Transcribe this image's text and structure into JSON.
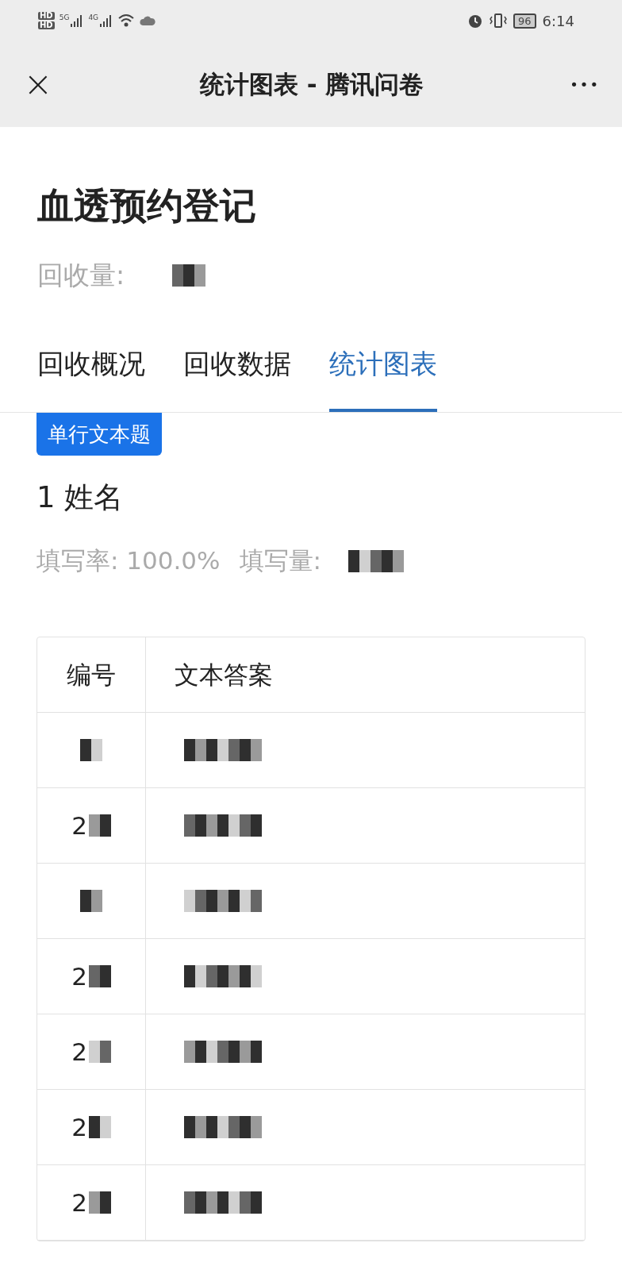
{
  "status_bar": {
    "sim_labels": [
      "HD",
      "HD"
    ],
    "network_labels": [
      "5G",
      "4G"
    ],
    "battery": "96",
    "time": "6:14"
  },
  "nav_bar": {
    "close": "×",
    "title": "统计图表 - 腾讯问卷",
    "more": "•••"
  },
  "survey": {
    "title": "血透预约登记",
    "count_label": "回收量:"
  },
  "tabs": [
    {
      "label": "回收概况",
      "selected": false
    },
    {
      "label": "回收数据",
      "selected": false
    },
    {
      "label": "统计图表",
      "selected": true
    }
  ],
  "question": {
    "tag": "单行文本题",
    "title": "1 姓名",
    "fill_rate": "填写率: 100.0%",
    "fill_count_label": "填写量:"
  },
  "table": {
    "columns": [
      "编号",
      "文本答案"
    ],
    "rows": [
      {
        "number": ""
      },
      {
        "number": "2"
      },
      {
        "number": ""
      },
      {
        "number": "2"
      },
      {
        "number": "2"
      },
      {
        "number": "2"
      },
      {
        "number": "2"
      }
    ]
  }
}
